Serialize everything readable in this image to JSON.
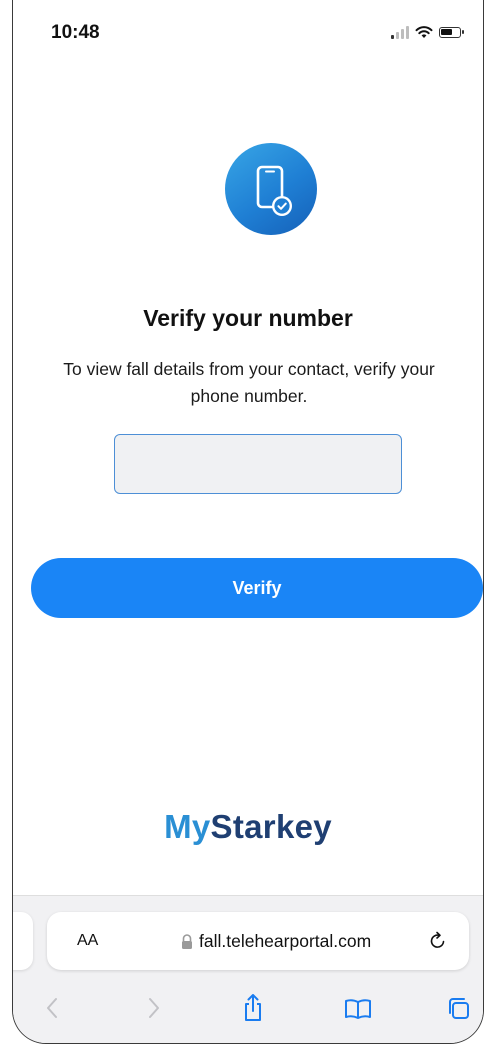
{
  "status_bar": {
    "time": "10:48"
  },
  "verify": {
    "title": "Verify your number",
    "description": "To view fall details from your contact, verify your phone number.",
    "phone_value": "",
    "button_label": "Verify"
  },
  "logo": {
    "my": "My",
    "brand": "Starkey"
  },
  "browser": {
    "text_size_label": "AA",
    "url": "fall.telehearportal.com"
  },
  "colors": {
    "primary_button": "#1a85f6",
    "logo_my": "#2a8fd4",
    "logo_brand": "#1f3f72",
    "input_border": "#4d8fd6"
  },
  "icons": {
    "hero": "phone-check-icon",
    "toolbar": [
      "back-icon",
      "forward-icon",
      "share-icon",
      "bookmarks-icon",
      "tabs-icon"
    ]
  }
}
